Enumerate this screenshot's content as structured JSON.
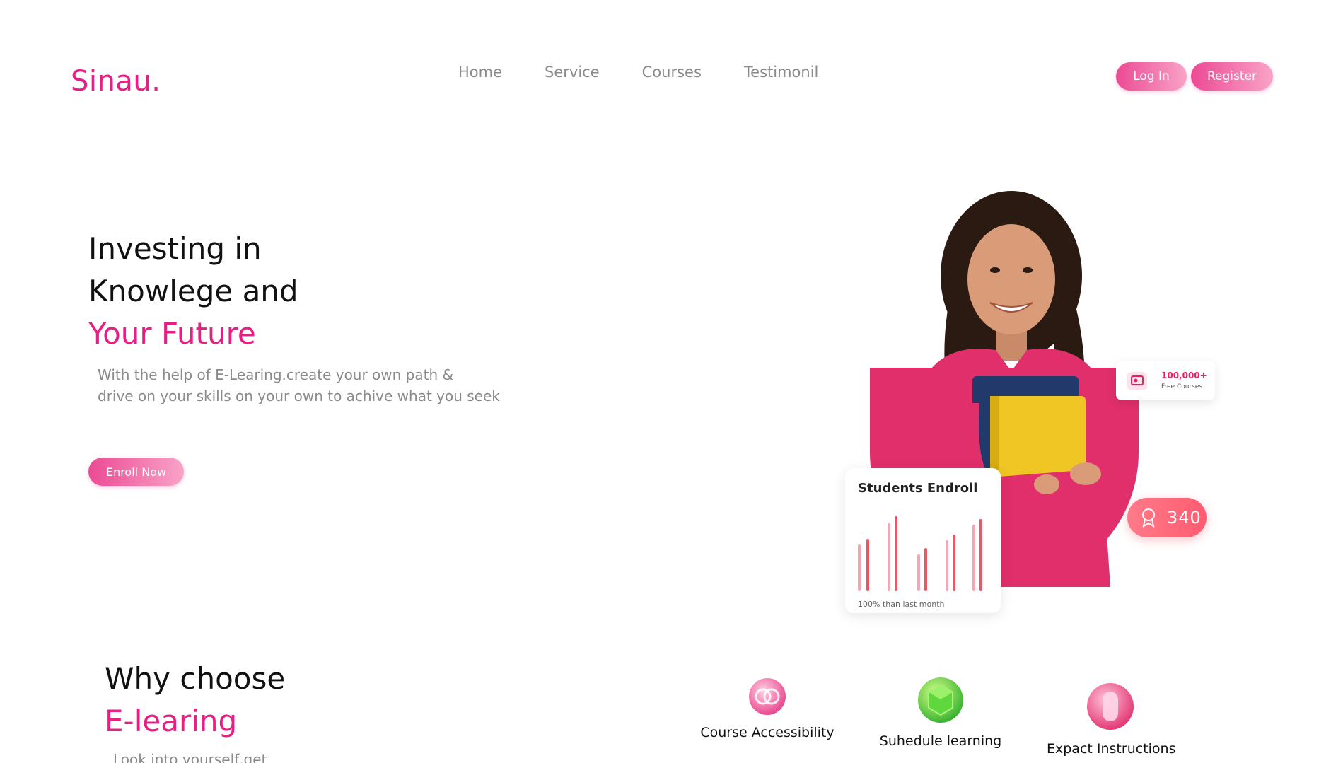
{
  "brand": {
    "logo": "Sinau."
  },
  "nav": {
    "items": [
      "Home",
      "Service",
      "Courses",
      "Testimonil"
    ]
  },
  "auth": {
    "login": "Log In",
    "register": "Register"
  },
  "hero": {
    "title_line1": "Investing in",
    "title_line2": "Knowlege and",
    "title_accent": "Your Future",
    "description_line1": "With the help of E-Learing.create your own path &",
    "description_line2": "drive on your skills on your own to achive what you seek",
    "cta": "Enroll Now"
  },
  "stats_card": {
    "title": "Students Endroll",
    "footnote": "100% than last month"
  },
  "courses_badge": {
    "count": "100,000+",
    "label": "Free Courses"
  },
  "count_badge": {
    "value": "340"
  },
  "why": {
    "title_line1": "Why choose",
    "title_accent": "E-learing",
    "description": "Look into yourself,get"
  },
  "features": [
    {
      "label": "Course Accessibility",
      "icon": "rings-icon"
    },
    {
      "label": "Suhedule learning",
      "icon": "gem-icon"
    },
    {
      "label": "Expact Instructions",
      "icon": "capsule-icon"
    }
  ],
  "colors": {
    "accent": "#e91e84",
    "muted": "#8a8a8a",
    "shirt": "#e02f6b"
  }
}
